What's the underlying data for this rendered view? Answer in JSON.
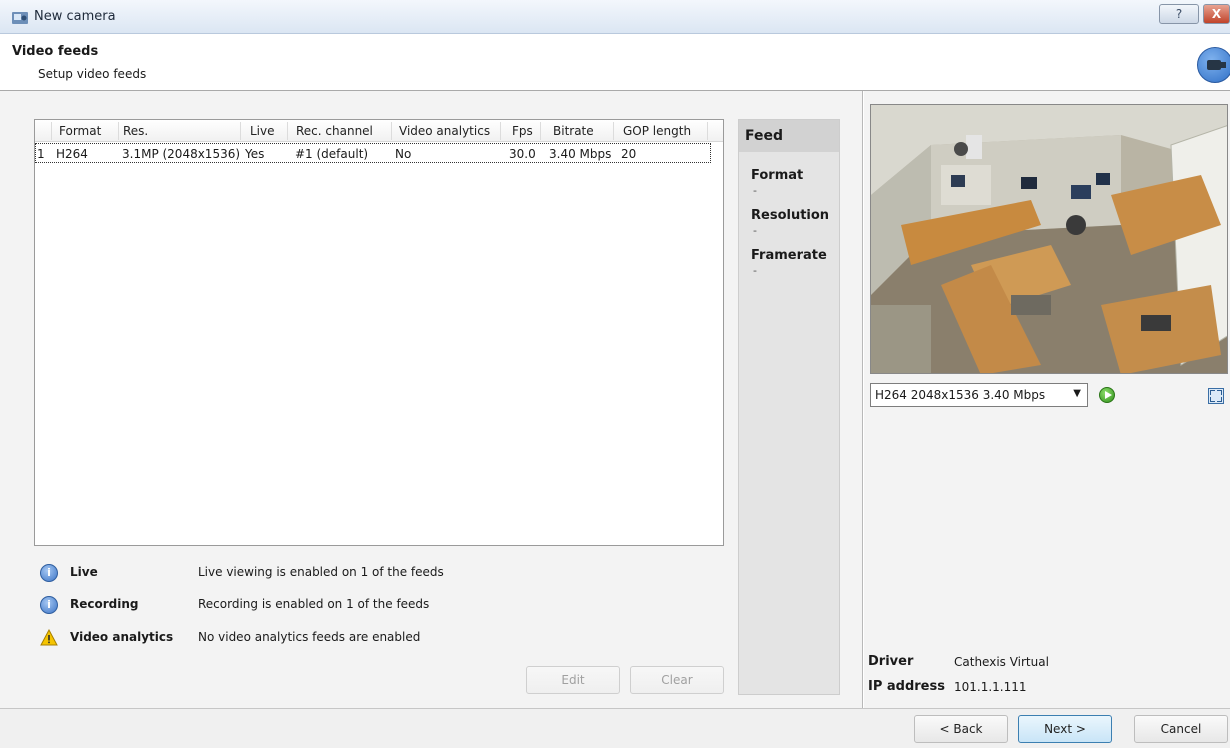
{
  "window": {
    "title": "New camera",
    "help_label": "?",
    "close_label": "X"
  },
  "header": {
    "title": "Video feeds",
    "subtitle": "Setup video feeds"
  },
  "feeds_table": {
    "columns": [
      "Format",
      "Res.",
      "Live",
      "Rec. channel",
      "Video analytics",
      "Fps",
      "Bitrate",
      "GOP length"
    ],
    "rows": [
      {
        "index": "1",
        "format": "H264",
        "res": "3.1MP (2048x1536)",
        "live": "Yes",
        "rec_channel": "#1 (default)",
        "video_analytics": "No",
        "fps": "30.0",
        "bitrate": "3.40 Mbps",
        "gop_length": "20"
      }
    ]
  },
  "summary": [
    {
      "icon": "info-icon",
      "label": "Live",
      "text": "Live viewing is enabled on 1 of the feeds"
    },
    {
      "icon": "info-icon",
      "label": "Recording",
      "text": "Recording is enabled on 1 of the feeds"
    },
    {
      "icon": "warning-icon",
      "label": "Video analytics",
      "text": "No video analytics feeds are enabled"
    }
  ],
  "actions": {
    "edit_label": "Edit",
    "clear_label": "Clear"
  },
  "feed_panel": {
    "title": "Feed",
    "format_label": "Format",
    "format_value": "-",
    "resolution_label": "Resolution",
    "resolution_value": "-",
    "framerate_label": "Framerate",
    "framerate_value": "-"
  },
  "preview": {
    "stream_selected": "H264 2048x1536 3.40 Mbps"
  },
  "camera_info": {
    "driver_label": "Driver",
    "driver_value": "Cathexis Virtual",
    "ip_label": "IP address",
    "ip_value": "101.1.1.111"
  },
  "footer": {
    "back_label": "< Back",
    "next_label": "Next >",
    "cancel_label": "Cancel"
  },
  "colors": {
    "titlebar": "#dbe6f3",
    "panel_bg": "#f3f3f3",
    "feed_panel_bg": "#e4e4e4",
    "accent": "#3c7fb1"
  }
}
